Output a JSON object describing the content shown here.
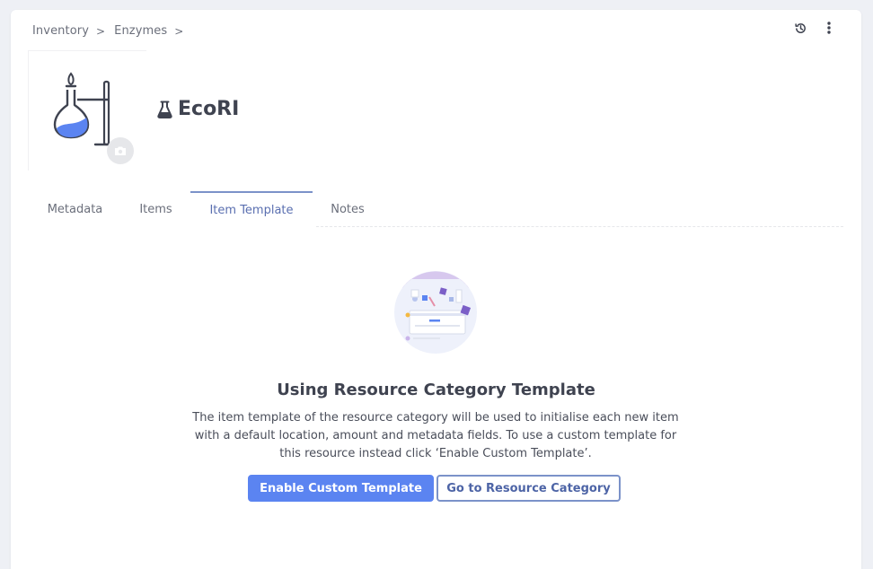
{
  "breadcrumb": {
    "items": [
      "Inventory",
      "Enzymes"
    ],
    "separator": ">"
  },
  "header": {
    "title": "EcoRI",
    "icons": {
      "history": "history-icon",
      "more": "more-vertical-icon",
      "flask": "flask-icon",
      "camera": "camera-icon"
    }
  },
  "tabs": [
    {
      "label": "Metadata",
      "active": false
    },
    {
      "label": "Items",
      "active": false
    },
    {
      "label": "Item Template",
      "active": true
    },
    {
      "label": "Notes",
      "active": false
    }
  ],
  "empty_state": {
    "title": "Using Resource Category Template",
    "description": "The item template of the resource category will be used to initialise each new item with a default location, amount and metadata fields. To use a custom template for this resource instead click ‘Enable Custom Template’.",
    "primary_button": "Enable Custom Template",
    "secondary_button": "Go to Resource Category"
  },
  "colors": {
    "primary": "#5b84f1",
    "active_tab": "#5a6fb0",
    "text": "#3f4350"
  }
}
